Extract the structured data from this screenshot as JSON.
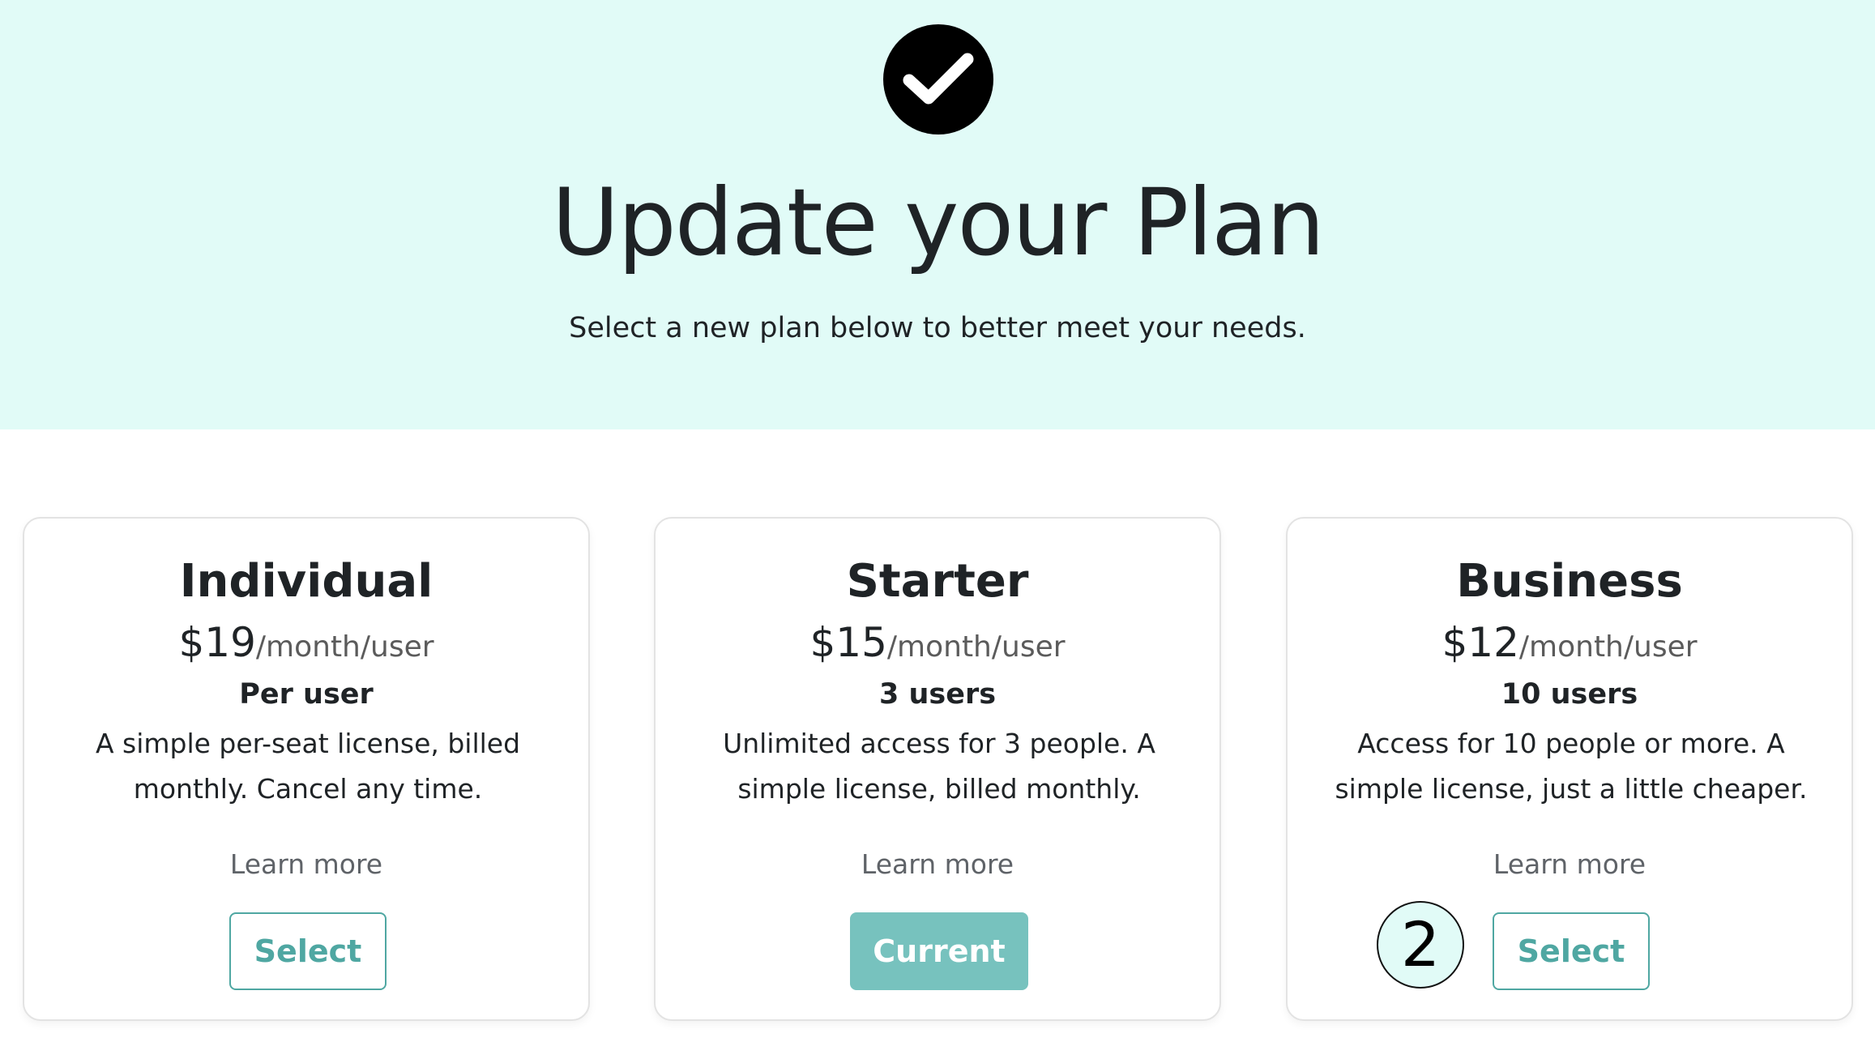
{
  "header": {
    "icon": "check-circle-icon",
    "title": "Update your Plan",
    "subtitle": "Select a new plan below to better meet your needs."
  },
  "plans": [
    {
      "name": "Individual",
      "price": "$19",
      "price_unit": "/month/user",
      "seats": "Per user",
      "description": "A simple per-seat license, billed monthly. Cancel any time.",
      "learn_more": "Learn more",
      "button_label": "Select"
    },
    {
      "name": "Starter",
      "price": "$15",
      "price_unit": "/month/user",
      "seats": "3 users",
      "description": "Unlimited access for 3 people. A simple license, billed monthly.",
      "learn_more": "Learn more",
      "button_label": "Current"
    },
    {
      "name": "Business",
      "price": "$12",
      "price_unit": "/month/user",
      "seats": "10 users",
      "description": "Access for 10 people or more. A simple license, just a little cheaper.",
      "learn_more": "Learn more",
      "button_label": "Select",
      "step_badge": "2"
    }
  ],
  "colors": {
    "hero_background": "#e1fbf7",
    "accent": "#4fa7a2",
    "current_button": "#77c2be",
    "text": "#1f2326",
    "muted_text": "#5f6368"
  }
}
